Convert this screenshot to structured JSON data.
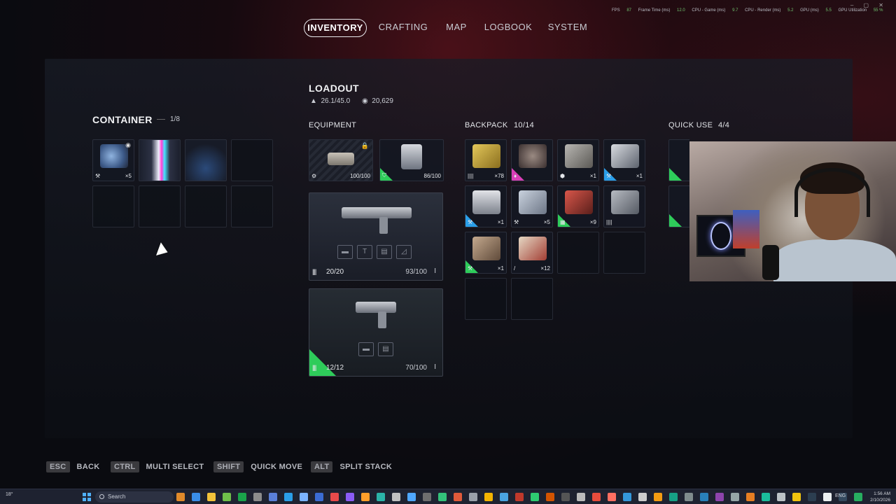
{
  "nav": {
    "tabs": [
      "INVENTORY",
      "CRAFTING",
      "MAP",
      "LOGBOOK",
      "SYSTEM"
    ],
    "active": "INVENTORY"
  },
  "perf": {
    "fps_label": "FPS",
    "fps_value": "87",
    "frame_label": "Frame Time (ms)",
    "frame_value": "12.0",
    "cpu_game_label": "CPU - Game (ms)",
    "cpu_game_value": "9.7",
    "cpu_render_label": "CPU - Render (ms)",
    "cpu_render_value": "5.2",
    "gpu_label": "GPU (ms)",
    "gpu_value": "5.5",
    "gpu_util_label": "GPU Utilization",
    "gpu_util_value": "55 %"
  },
  "container": {
    "title": "CONTAINER",
    "count": "1/8",
    "slots": [
      {
        "count": "×5",
        "tag": "🔧",
        "style": "item"
      },
      {
        "count": "",
        "tag": "",
        "style": "rainbow"
      },
      {
        "count": "",
        "tag": "",
        "style": "glow"
      },
      {
        "count": "",
        "tag": "",
        "style": "empty"
      },
      {
        "count": "",
        "tag": "",
        "style": "empty"
      },
      {
        "count": "",
        "tag": "",
        "style": "empty"
      },
      {
        "count": "",
        "tag": "",
        "style": "empty"
      },
      {
        "count": "",
        "tag": "",
        "style": "empty"
      }
    ]
  },
  "loadout": {
    "title": "LOADOUT",
    "weight": "26.1/45.0",
    "currency": "20,629"
  },
  "equipment": {
    "title": "EQUIPMENT",
    "augment": {
      "durability": "100/100"
    },
    "shield": {
      "durability": "86/100"
    },
    "weapon1": {
      "ammo": "20/20",
      "durability": "93/100"
    },
    "weapon2": {
      "ammo": "12/12",
      "durability": "70/100"
    }
  },
  "backpack": {
    "title": "BACKPACK",
    "count": "10/14",
    "slots": [
      {
        "count": "×78",
        "rarity": "none"
      },
      {
        "count": "",
        "rarity": "pink"
      },
      {
        "count": "×1",
        "rarity": "none"
      },
      {
        "count": "×1",
        "rarity": "blue"
      },
      {
        "count": "×1",
        "rarity": "blue"
      },
      {
        "count": "×5",
        "rarity": "none"
      },
      {
        "count": "×9",
        "rarity": "green"
      },
      {
        "count": "",
        "rarity": "none"
      },
      {
        "count": "×1",
        "rarity": "green"
      },
      {
        "count": "×12",
        "rarity": "none"
      },
      {
        "count": "",
        "rarity": "empty"
      },
      {
        "count": "",
        "rarity": "empty"
      },
      {
        "count": "",
        "rarity": "empty"
      },
      {
        "count": "",
        "rarity": "empty"
      }
    ]
  },
  "quick_use": {
    "title": "QUICK USE",
    "count": "4/4"
  },
  "hints": [
    {
      "key": "ESC",
      "label": "BACK"
    },
    {
      "key": "CTRL",
      "label": "MULTI SELECT"
    },
    {
      "key": "SHIFT",
      "label": "QUICK MOVE"
    },
    {
      "key": "ALT",
      "label": "SPLIT STACK"
    }
  ],
  "taskbar": {
    "search_placeholder": "Search",
    "temp": "18°",
    "lang": "ENG",
    "time": "1:56 AM",
    "date": "2/10/2026"
  }
}
